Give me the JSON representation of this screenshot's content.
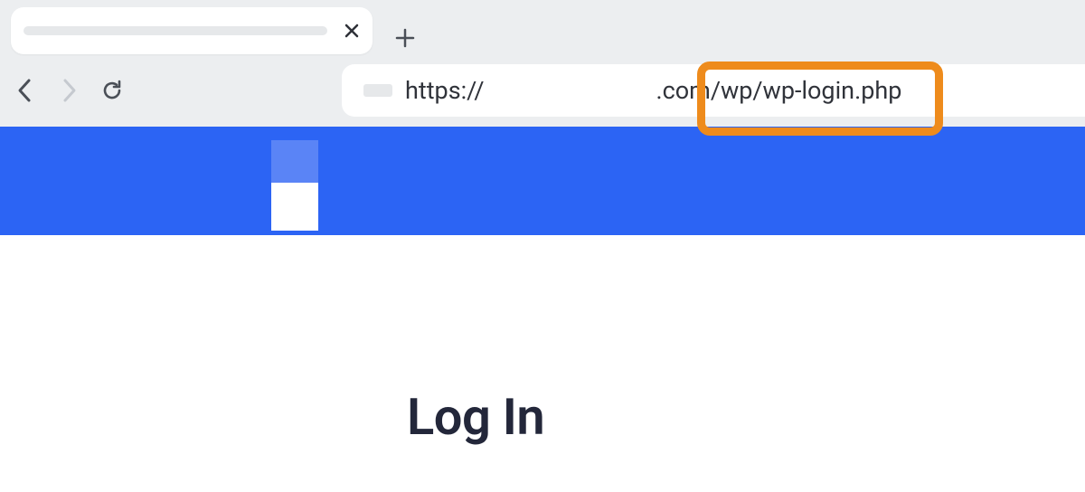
{
  "browser": {
    "tab": {
      "title": "",
      "close_tooltip": "Close tab"
    },
    "new_tab_tooltip": "New tab",
    "nav": {
      "back_tooltip": "Back",
      "forward_tooltip": "Forward",
      "reload_tooltip": "Reload"
    },
    "url": {
      "scheme": "https://",
      "tld": ".com",
      "path": "/wp/wp-login.php"
    }
  },
  "page": {
    "login_heading": "Log In"
  },
  "annotation": {
    "highlighted_segment": "/wp/wp-login.php"
  }
}
